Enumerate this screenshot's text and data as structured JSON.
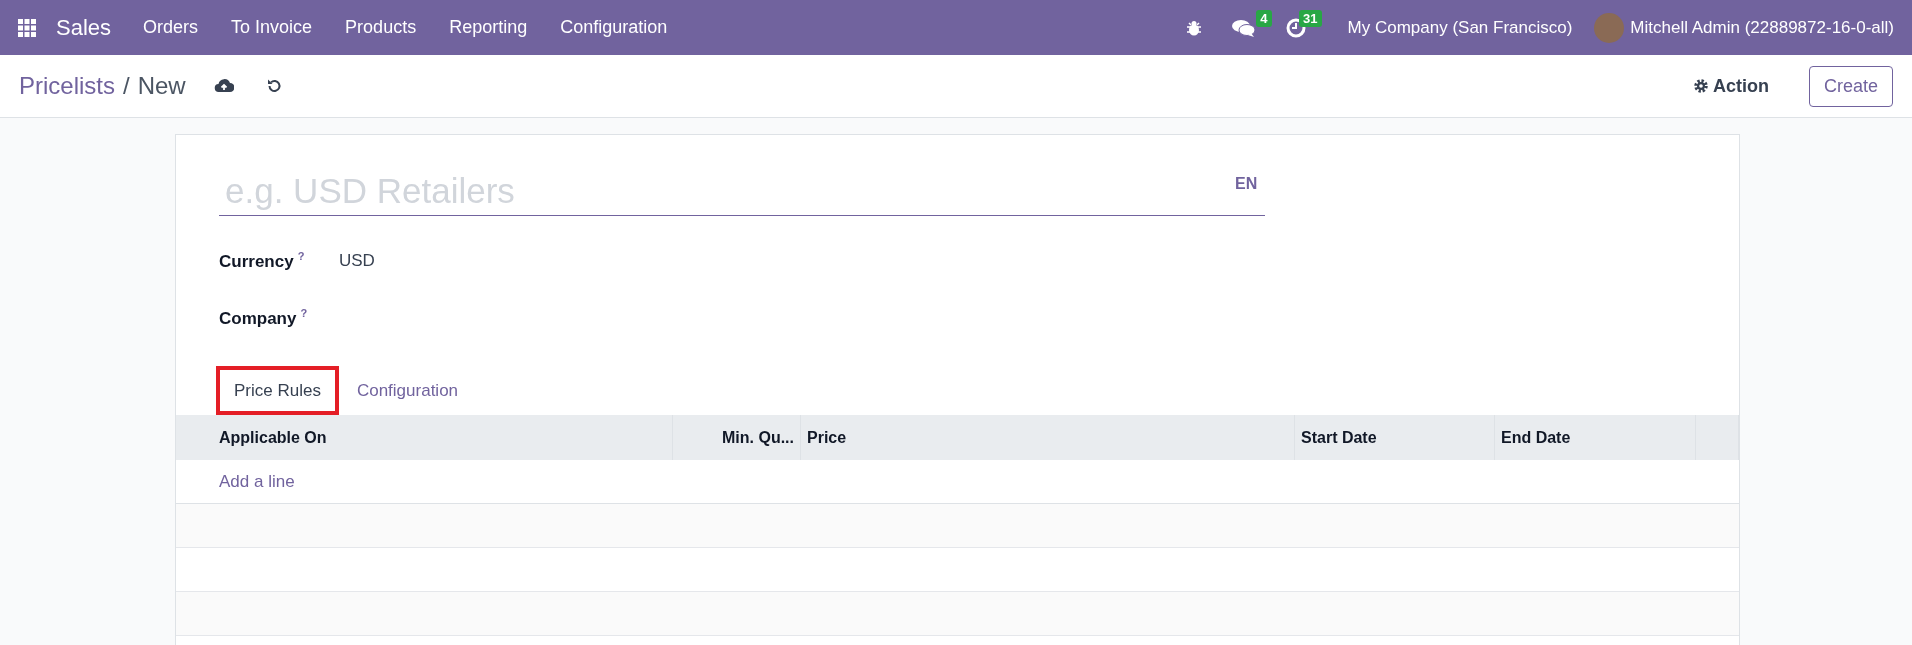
{
  "navbar": {
    "app": "Sales",
    "menu": [
      "Orders",
      "To Invoice",
      "Products",
      "Reporting",
      "Configuration"
    ],
    "messages_badge": "4",
    "activities_badge": "31",
    "company": "My Company (San Francisco)",
    "user": "Mitchell Admin (22889872-16-0-all)"
  },
  "breadcrumb": {
    "parent": "Pricelists",
    "separator": "/",
    "current": "New"
  },
  "actions": {
    "action": "Action",
    "create": "Create"
  },
  "form": {
    "name_placeholder": "e.g. USD Retailers",
    "language": "EN",
    "fields": [
      {
        "label": "Currency",
        "help": "?",
        "value": "USD"
      },
      {
        "label": "Company",
        "help": "?"
      }
    ]
  },
  "tabs": [
    {
      "label": "Price Rules",
      "selected": true,
      "highlighted": true
    },
    {
      "label": "Configuration",
      "selected": false,
      "highlighted": false
    }
  ],
  "table": {
    "columns": [
      {
        "label": "Applicable On"
      },
      {
        "label": "Min. Qu..."
      },
      {
        "label": "Price"
      },
      {
        "label": "Start Date"
      },
      {
        "label": "End Date"
      }
    ],
    "add_line": "Add a line"
  }
}
